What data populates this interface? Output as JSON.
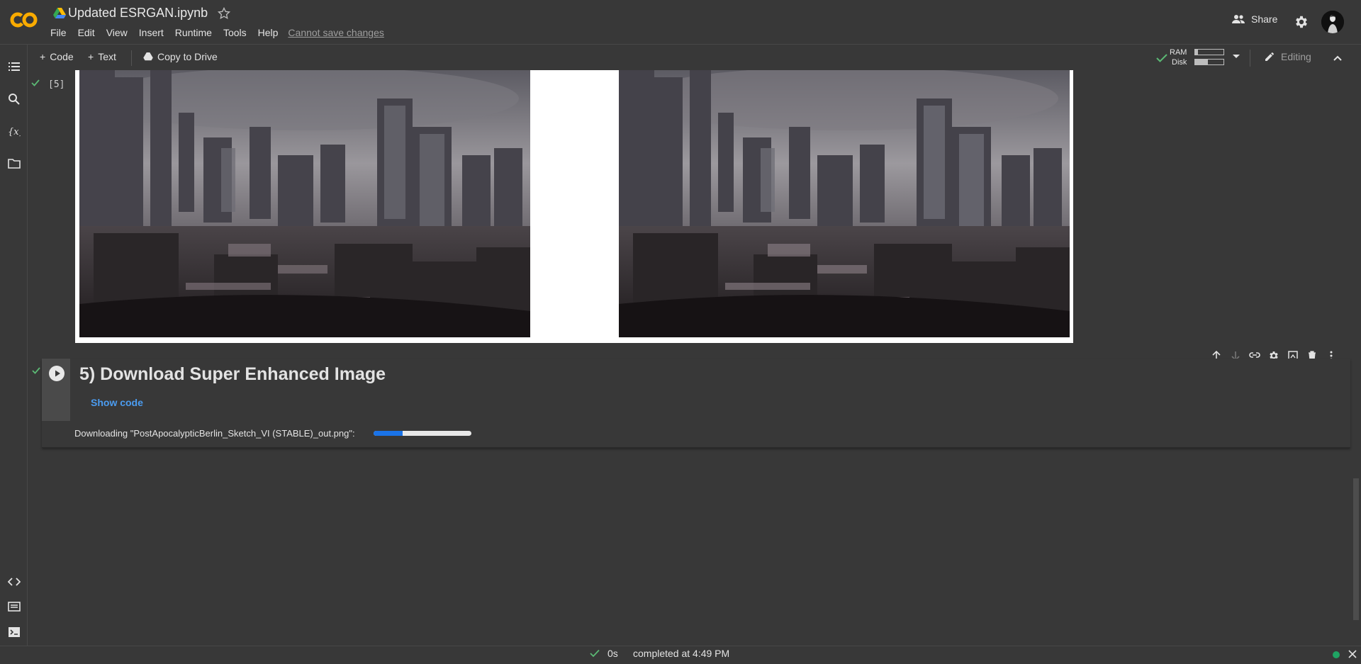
{
  "header": {
    "title": "Updated ESRGAN.ipynb",
    "menu": [
      "File",
      "Edit",
      "View",
      "Insert",
      "Runtime",
      "Tools",
      "Help"
    ],
    "save_status": "Cannot save changes",
    "share_label": "Share"
  },
  "toolbar": {
    "add_code": "Code",
    "add_text": "Text",
    "copy_to_drive": "Copy to Drive",
    "ram_label": "RAM",
    "disk_label": "Disk",
    "ram_usage": 0.1,
    "disk_usage": 0.45,
    "editing_label": "Editing"
  },
  "cells": {
    "output_cell": {
      "exec_count": "[5]"
    },
    "download_cell": {
      "title": "5) Download Super Enhanced Image",
      "show_code": "Show code",
      "download_message": "Downloading \"PostApocalypticBerlin_Sketch_VI (STABLE)_out.png\":",
      "progress": 0.3
    }
  },
  "status": {
    "elapsed": "0s",
    "message": "completed at 4:49 PM"
  },
  "colors": {
    "accent": "#1a73e8",
    "link": "#4b9cf0",
    "success": "#5bb974",
    "logo_orange": "#f9ab00",
    "connected": "#1fa463"
  }
}
